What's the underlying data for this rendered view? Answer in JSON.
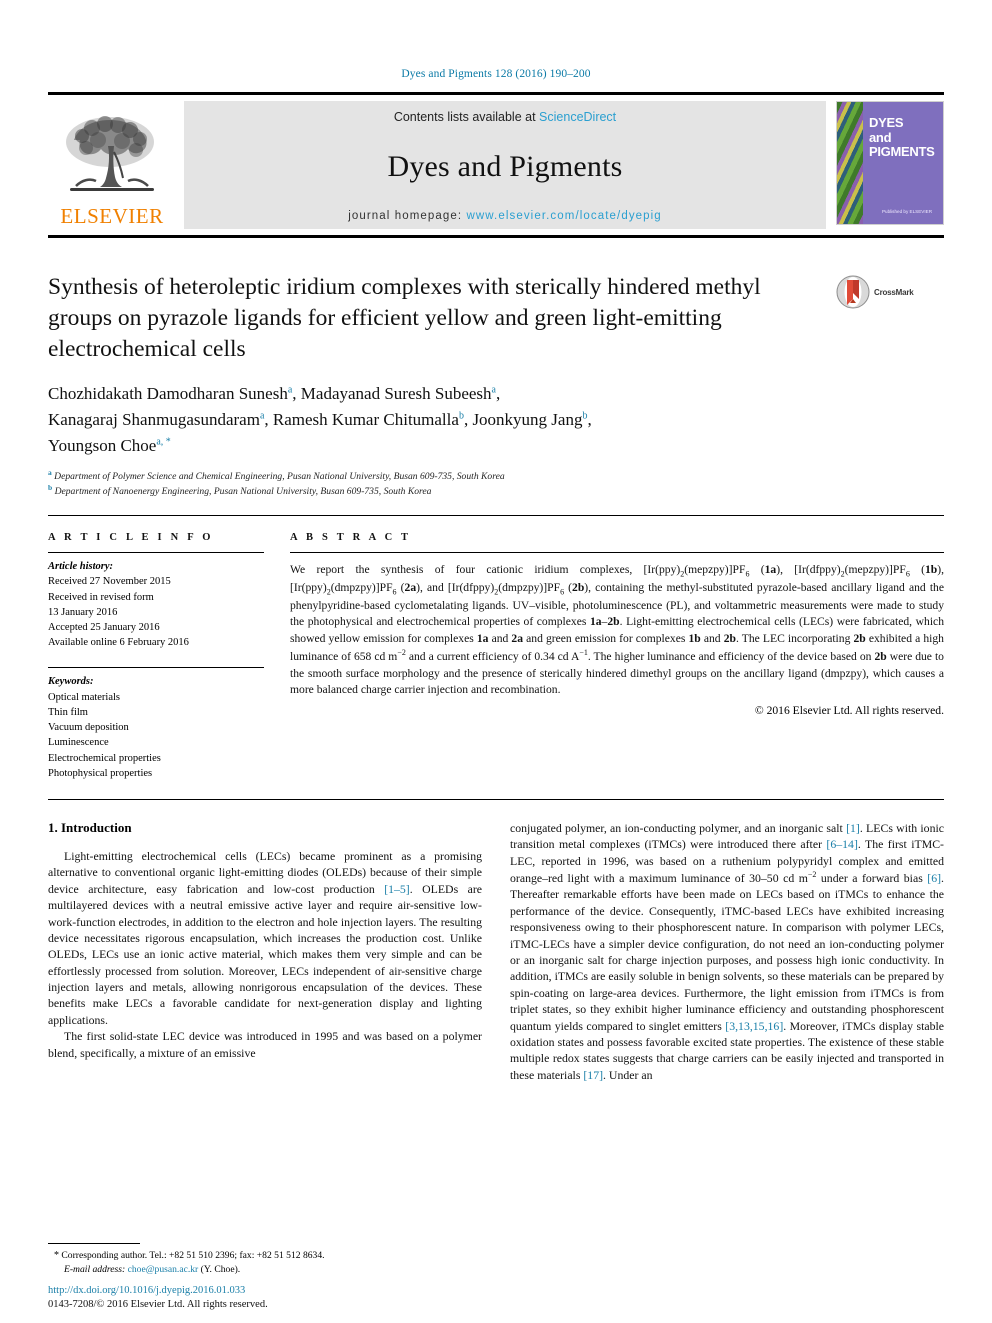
{
  "running_head": "Dyes and Pigments 128 (2016) 190–200",
  "masthead": {
    "publisher_name": "ELSEVIER",
    "contents_prefix": "Contents lists available at",
    "contents_link": "ScienceDirect",
    "journal_title": "Dyes and Pigments",
    "homepage_prefix": "journal homepage:",
    "homepage_url": "www.elsevier.com/locate/dyepig",
    "cover": {
      "line1": "DYES",
      "line2": "and",
      "line3": "PIGMENTS",
      "footer": "Published by ELSEVIER"
    }
  },
  "title_block": {
    "title": "Synthesis of heteroleptic iridium complexes with sterically hindered methyl groups on pyrazole ligands for efficient yellow and green light-emitting electrochemical cells",
    "crossmark_label": "CrossMark"
  },
  "authors": {
    "line1_name1": "Chozhidakath Damodharan Sunesh",
    "line1_sup1": "a",
    "line1_name2": "Madayanad Suresh Subeesh",
    "line1_sup2": "a",
    "line2_name1": "Kanagaraj Shanmugasundaram",
    "line2_sup1": "a",
    "line2_name2": "Ramesh Kumar Chitumalla",
    "line2_sup2": "b",
    "line2_name3": "Joonkyung Jang",
    "line2_sup3": "b",
    "line3_name1": "Youngson Choe",
    "line3_sup1": "a, *",
    "affiliations": [
      {
        "marker": "a",
        "text": "Department of Polymer Science and Chemical Engineering, Pusan National University, Busan 609-735, South Korea"
      },
      {
        "marker": "b",
        "text": "Department of Nanoenergy Engineering, Pusan National University, Busan 609-735, South Korea"
      }
    ]
  },
  "article_info": {
    "heading": "A R T I C L E   I N F O",
    "history_label": "Article history:",
    "history_lines": [
      "Received 27 November 2015",
      "Received in revised form",
      "13 January 2016",
      "Accepted 25 January 2016",
      "Available online 6 February 2016"
    ],
    "keywords_label": "Keywords:",
    "keywords": [
      "Optical materials",
      "Thin film",
      "Vacuum deposition",
      "Luminescence",
      "Electrochemical properties",
      "Photophysical properties"
    ]
  },
  "abstract": {
    "heading": "A B S T R A C T",
    "text_html": "We report the synthesis of four cationic iridium complexes, [Ir(ppy)<sub>2</sub>(mepzpy)]PF<sub>6</sub> (<b>1a</b>), [Ir(dfppy)<sub>2</sub>(mepzpy)]PF<sub>6</sub> (<b>1b</b>), [Ir(ppy)<sub>2</sub>(dmpzpy)]PF<sub>6</sub> (<b>2a</b>), and [Ir(dfppy)<sub>2</sub>(dmpzpy)]PF<sub>6</sub> (<b>2b</b>), containing the methyl-substituted pyrazole-based ancillary ligand and the phenylpyridine-based cyclometalating ligands. UV–visible, photoluminescence (PL), and voltammetric measurements were made to study the photophysical and electrochemical properties of complexes <b>1a</b>–<b>2b</b>. Light-emitting electrochemical cells (LECs) were fabricated, which showed yellow emission for complexes <b>1a</b> and <b>2a</b> and green emission for complexes <b>1b</b> and <b>2b</b>. The LEC incorporating <b>2b</b> exhibited a high luminance of 658 cd m<sup>−2</sup> and a current efficiency of 0.34 cd A<sup>−1</sup>. The higher luminance and efficiency of the device based on <b>2b</b> were due to the smooth surface morphology and the presence of sterically hindered dimethyl groups on the ancillary ligand (dmpzpy), which causes a more balanced charge carrier injection and recombination.",
    "copyright": "© 2016 Elsevier Ltd. All rights reserved."
  },
  "body": {
    "section_number_title": "1.  Introduction",
    "left_paragraph_1_html": "Light-emitting electrochemical cells (LECs) became prominent as a promising alternative to conventional organic light-emitting diodes (OLEDs) because of their simple device architecture, easy fabrication and low-cost production <span class=\"ref\">[1–5]</span>. OLEDs are multilayered devices with a neutral emissive active layer and require air-sensitive low-work-function electrodes, in addition to the electron and hole injection layers. The resulting device necessitates rigorous encapsulation, which increases the production cost. Unlike OLEDs, LECs use an ionic active material, which makes them very simple and can be effortlessly processed from solution. Moreover, LECs independent of air-sensitive charge injection layers and metals, allowing nonrigorous encapsulation of the devices. These benefits make LECs a favorable candidate for next-generation display and lighting applications.",
    "left_paragraph_2_html": "The first solid-state LEC device was introduced in 1995 and was based on a polymer blend, specifically, a mixture of an emissive",
    "right_paragraph_1_html": "conjugated polymer, an ion-conducting polymer, and an inorganic salt <span class=\"ref\">[1]</span>. LECs with ionic transition metal complexes (iTMCs) were introduced there after <span class=\"ref\">[6–14]</span>. The first iTMC-LEC, reported in 1996, was based on a ruthenium polypyridyl complex and emitted orange–red light with a maximum luminance of 30–50 cd m<sup>−2</sup> under a forward bias <span class=\"ref\">[6]</span>. Thereafter remarkable efforts have been made on LECs based on iTMCs to enhance the performance of the device. Consequently, iTMC-based LECs have exhibited increasing responsiveness owing to their phosphorescent nature. In comparison with polymer LECs, iTMC-LECs have a simpler device configuration, do not need an ion-conducting polymer or an inorganic salt for charge injection purposes, and possess high ionic conductivity. In addition, iTMCs are easily soluble in benign solvents, so these materials can be prepared by spin-coating on large-area devices. Furthermore, the light emission from iTMCs is from triplet states, so they exhibit higher luminance efficiency and outstanding phosphorescent quantum yields compared to singlet emitters <span class=\"ref\">[3,13,15,16]</span>. Moreover, iTMCs display stable oxidation states and possess favorable excited state properties. The existence of these stable multiple redox states suggests that charge carriers can be easily injected and transported in these materials <span class=\"ref\">[17]</span>. Under an"
  },
  "footnote": {
    "star": "*",
    "corresponding_text": "Corresponding author. Tel.: +82 51 510 2396; fax: +82 51 512 8634.",
    "email_label": "E-mail address:",
    "email": "choe@pusan.ac.kr",
    "email_suffix": "(Y. Choe)."
  },
  "footer": {
    "doi": "http://dx.doi.org/10.1016/j.dyepig.2016.01.033",
    "issn_line": "0143-7208/© 2016 Elsevier Ltd. All rights reserved."
  },
  "colors": {
    "link": "#1a7fa8",
    "sciencedirect": "#2a9fd0",
    "elsevier_orange": "#f08000",
    "cover_purple": "#7f6fbe"
  }
}
